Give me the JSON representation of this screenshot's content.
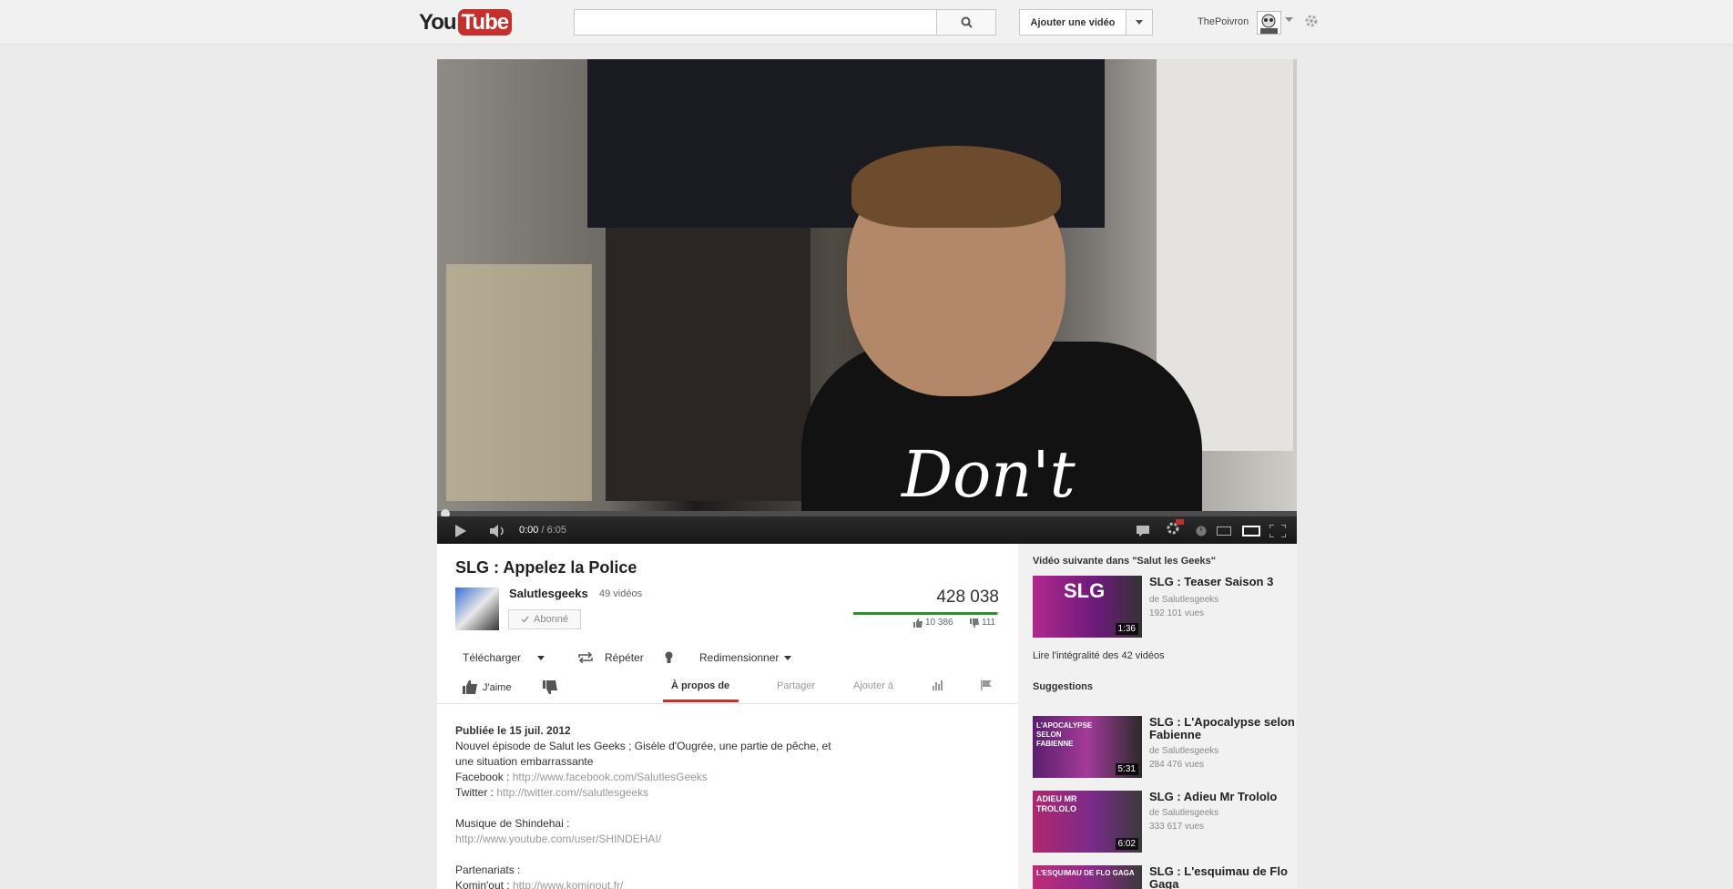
{
  "header": {
    "logo_you": "You",
    "logo_tube": "Tube",
    "search_placeholder": "",
    "upload_label": "Ajouter une vidéo",
    "username": "ThePoivron"
  },
  "player": {
    "current_time": "0:00",
    "separator": " / ",
    "duration": "6:05",
    "progress": 0.0,
    "overlay_text": "Don't"
  },
  "video": {
    "title": "SLG : Appelez la Police",
    "channel_name": "Salutlesgeeks",
    "channel_videos": "49 vidéos",
    "subscribe_label": "Abonné",
    "views": "428 038",
    "likes": "10 386",
    "dislikes": "111",
    "like_ratio": 0.989
  },
  "actions": {
    "download": "Télécharger",
    "repeat": "Répéter",
    "resize": "Redimensionner",
    "like": "J'aime"
  },
  "tabs": {
    "about": "À propos de",
    "share": "Partager",
    "add_to": "Ajouter à"
  },
  "description": {
    "published": "Publiée le 15 juil. 2012",
    "line1": "Nouvel épisode de Salut les Geeks ; Gisèle d'Ougrée, une partie de pêche, et une situation embarrassante",
    "facebook_label": "Facebook : ",
    "facebook_url": "http://www.facebook.com/SalutlesGeeks",
    "twitter_label": "Twitter : ",
    "twitter_url": "http://twitter.com//salutlesgeeks",
    "music_label": "Musique de Shindehai :",
    "music_url": "http://www.youtube.com/user/SHINDEHAI/",
    "partners_label": "Partenariats :",
    "kominout_label": "Komin'out : ",
    "kominout_url": "http://www.kominout.fr/"
  },
  "sidebar": {
    "next_heading": "Vidéo suivante dans \"Salut les Geeks\"",
    "next_video": {
      "title": "SLG : Teaser Saison 3",
      "by": "de Salutlesgeeks",
      "views": "192 101 vues",
      "duration": "1:36",
      "thumb_text": "SLG"
    },
    "playlist_link": "Lire l'intégralité des 42 vidéos",
    "suggestions_heading": "Suggestions",
    "suggestions": [
      {
        "title": "SLG : L'Apocalypse selon Fabienne",
        "by": "de Salutlesgeeks",
        "views": "284 476 vues",
        "duration": "5:31",
        "thumb_text": "L'APOCALYPSE SELON FABIENNE"
      },
      {
        "title": "SLG : Adieu Mr Trololo",
        "by": "de Salutlesgeeks",
        "views": "333 617 vues",
        "duration": "6:02",
        "thumb_text": "ADIEU MR TROLOLO"
      },
      {
        "title": "SLG : L'esquimau de Flo Gaga",
        "by": "",
        "views": "",
        "duration": "",
        "thumb_text": "L'ESQUIMAU DE FLO GAGA"
      }
    ]
  },
  "colors": {
    "brand_red": "#c4302b",
    "like_green": "#2f8f2f",
    "page_bg": "#ebebeb"
  },
  "icons": [
    "search-icon",
    "chevron-down-icon",
    "gear-icon",
    "play-icon",
    "volume-icon",
    "captions-icon",
    "settings-icon",
    "hd-badge",
    "watch-later-icon",
    "small-player-icon",
    "large-player-icon",
    "fullscreen-icon",
    "thumbs-up-icon",
    "thumbs-down-icon",
    "repeat-icon",
    "lightbulb-icon",
    "stats-icon",
    "flag-icon",
    "check-icon"
  ]
}
